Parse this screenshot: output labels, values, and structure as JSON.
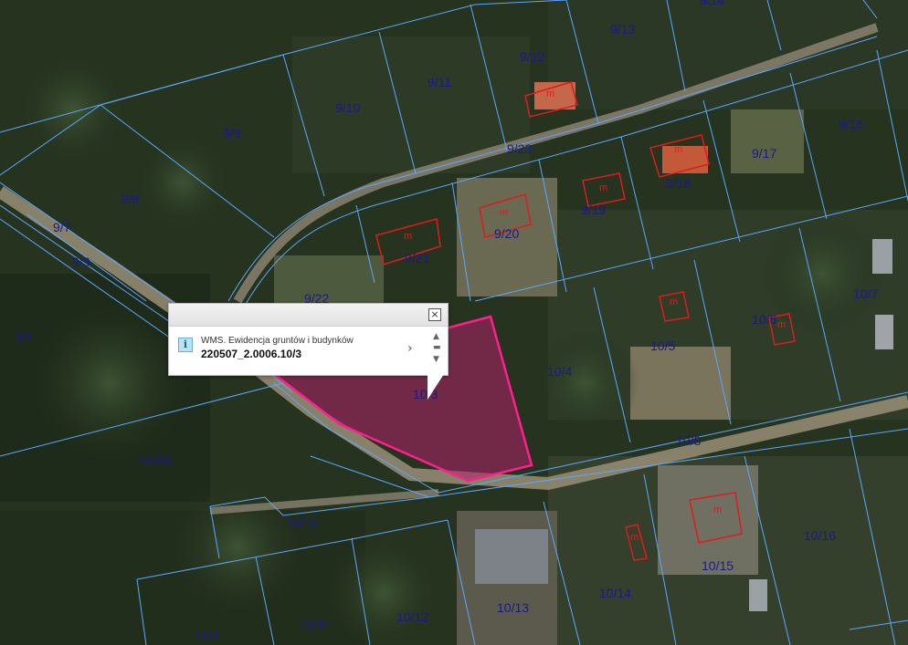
{
  "map": {
    "parcel_line_color": "#5aa8ff",
    "building_color": "#e01b1b",
    "selection_fill": "#b0206a",
    "selection_stroke": "#ff1f8e",
    "parcels": [
      {
        "label": "9/14"
      },
      {
        "label": "9/13"
      },
      {
        "label": "9/12"
      },
      {
        "label": "9/11"
      },
      {
        "label": "9/10"
      },
      {
        "label": "9/9"
      },
      {
        "label": "9/8"
      },
      {
        "label": "9/7"
      },
      {
        "label": "9/3"
      },
      {
        "label": "9/4"
      },
      {
        "label": "9/16"
      },
      {
        "label": "9/17"
      },
      {
        "label": "9/18"
      },
      {
        "label": "9/19"
      },
      {
        "label": "9/20"
      },
      {
        "label": "9/21"
      },
      {
        "label": "9/22"
      },
      {
        "label": "9/23"
      },
      {
        "label": "10/7"
      },
      {
        "label": "10/6"
      },
      {
        "label": "10/5"
      },
      {
        "label": "10/4"
      },
      {
        "label": "10/3"
      },
      {
        "label": "10/8"
      },
      {
        "label": "10/18"
      },
      {
        "label": "10/10"
      },
      {
        "label": "10/16"
      },
      {
        "label": "10/15"
      },
      {
        "label": "10/14"
      },
      {
        "label": "10/13"
      },
      {
        "label": "10/12"
      },
      {
        "label": "10/11"
      },
      {
        "label": "10/1"
      }
    ],
    "building_marker": "m"
  },
  "popup": {
    "layer_name": "WMS. Ewidencja gruntów i budynków",
    "feature_id": "220507_2.0006.10/3",
    "close_glyph": "×",
    "info_glyph": "i",
    "next_glyph": "›",
    "scroll_up_glyph": "▲",
    "scroll_mid_glyph": "▬",
    "scroll_down_glyph": "▼"
  }
}
